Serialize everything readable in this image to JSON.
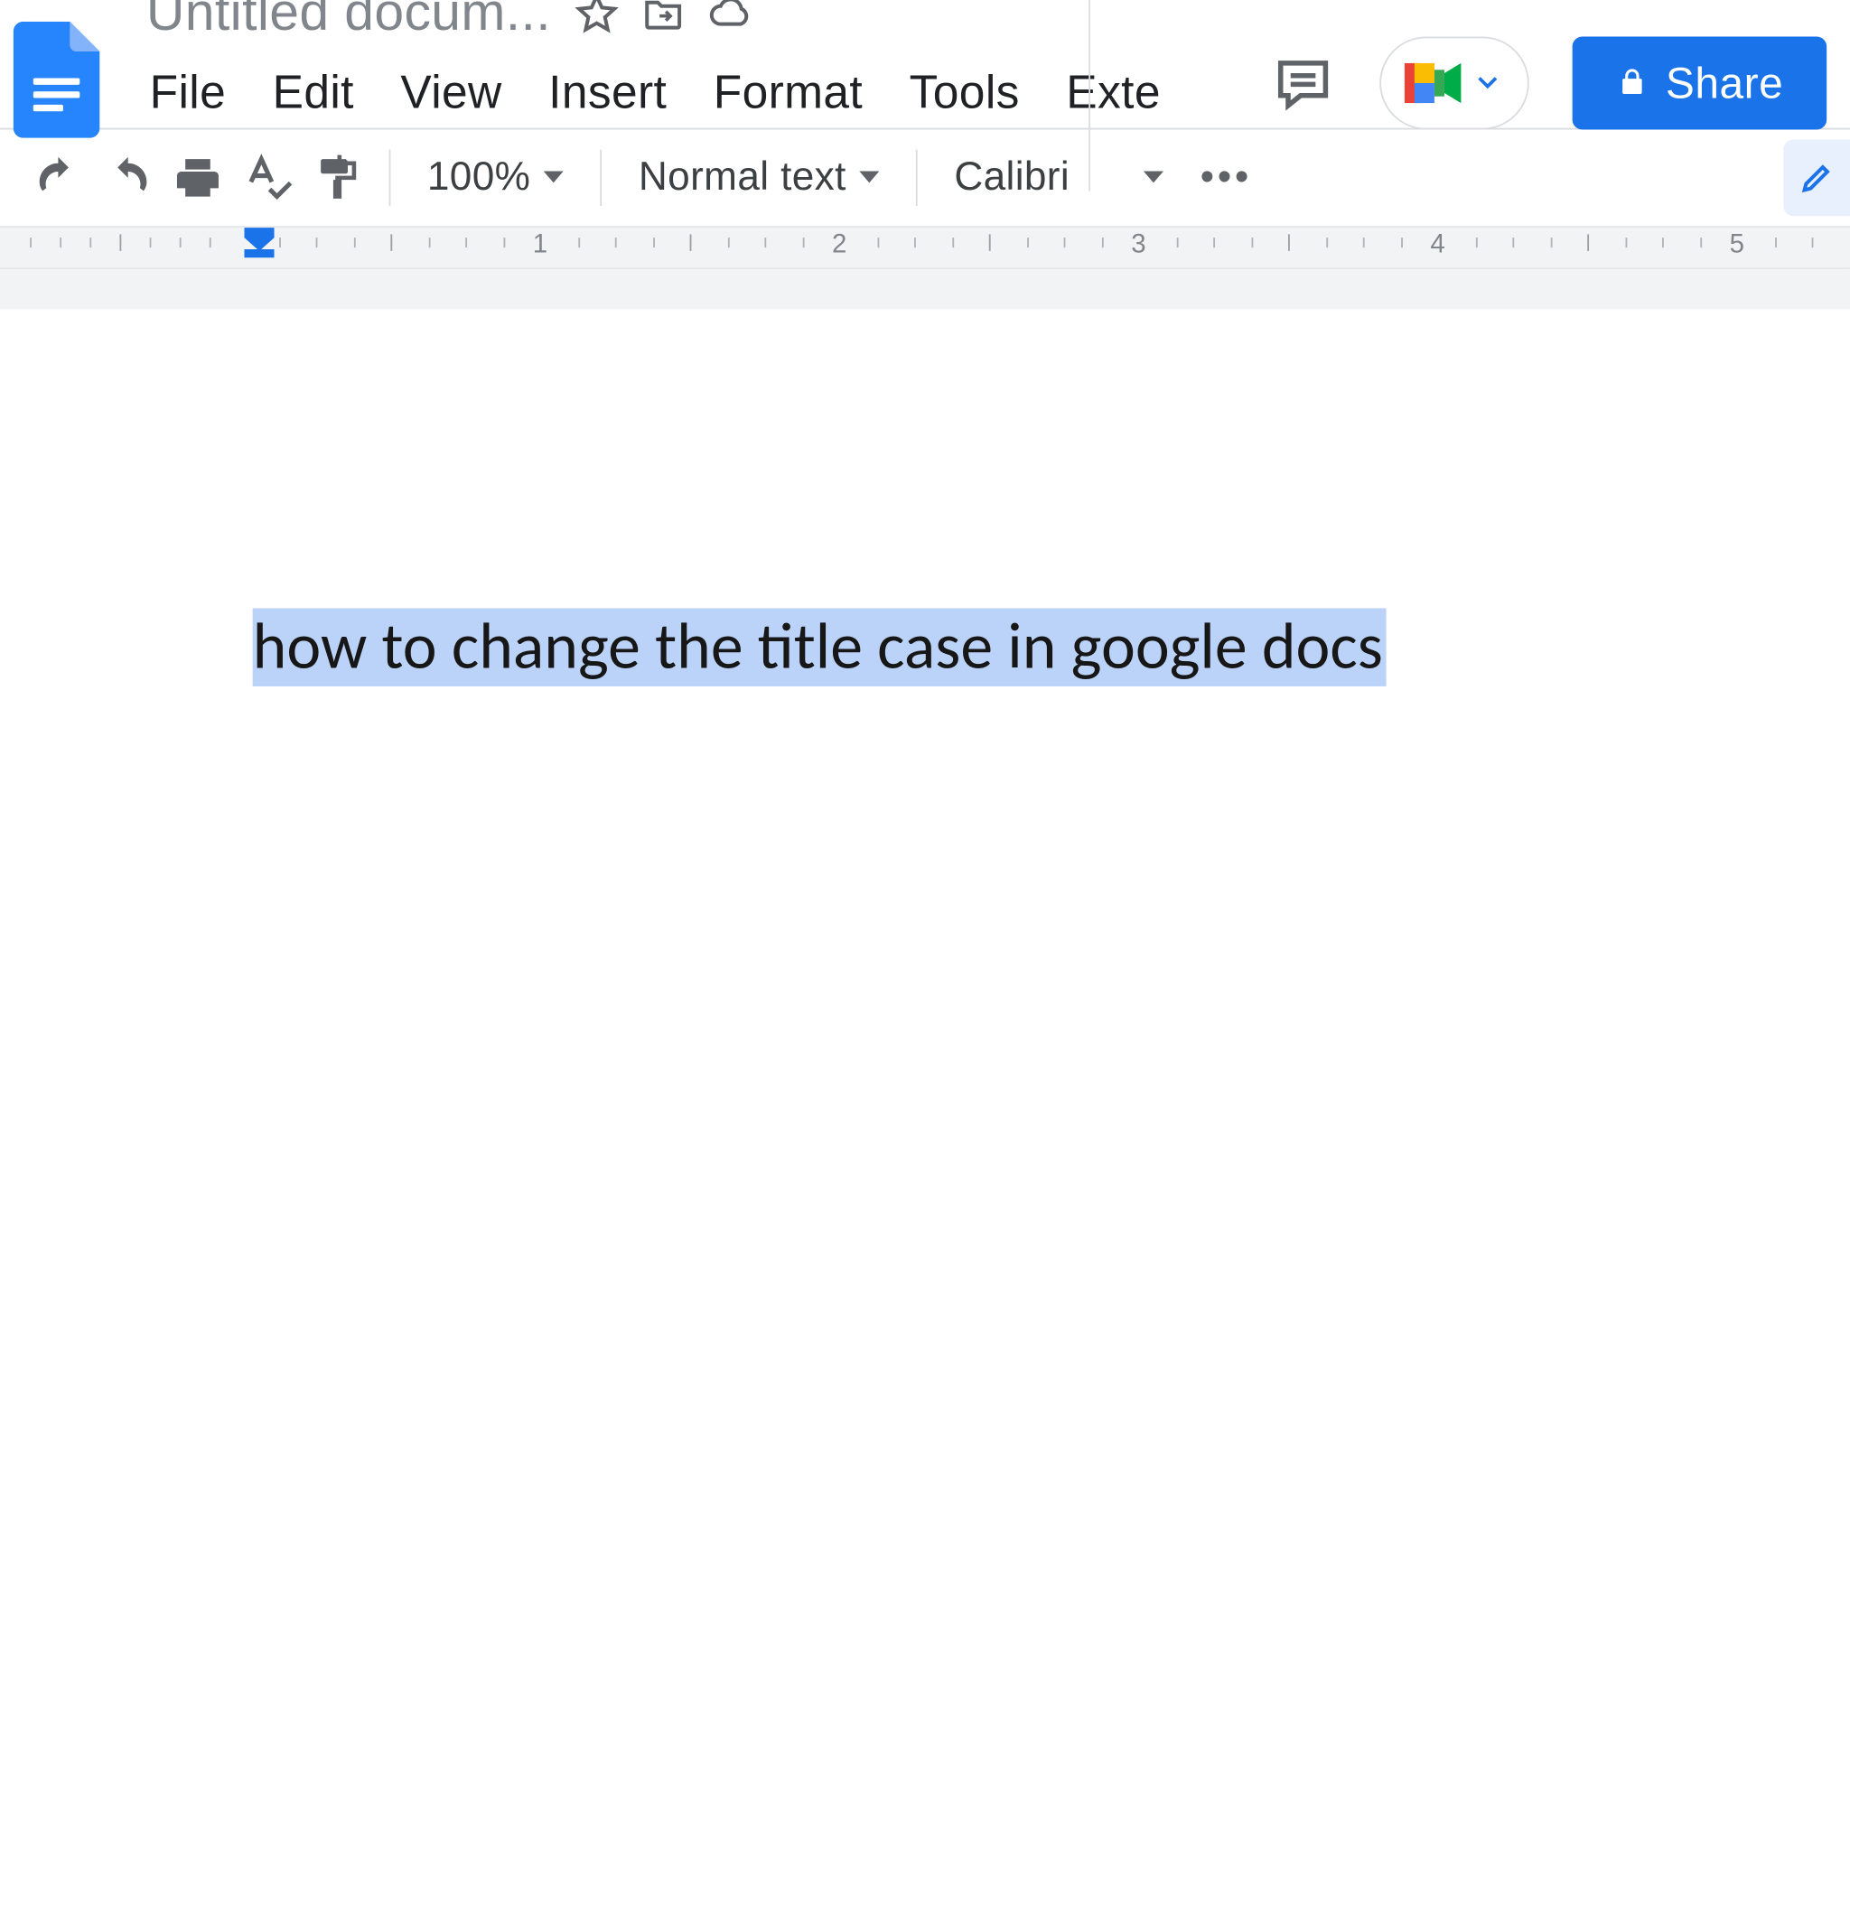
{
  "header": {
    "doc_title": "Untitled docum...",
    "menus": [
      "File",
      "Edit",
      "View",
      "Insert",
      "Format",
      "Tools",
      "Exte"
    ],
    "share_label": "Share"
  },
  "toolbar": {
    "zoom": "100%",
    "paragraph_style": "Normal text",
    "font": "Calibri",
    "editing_mode": "Editing"
  },
  "ruler": {
    "labels": [
      "1",
      "2",
      "3",
      "4",
      "5"
    ]
  },
  "document": {
    "selected_text": "how to change the title case in google docs"
  }
}
